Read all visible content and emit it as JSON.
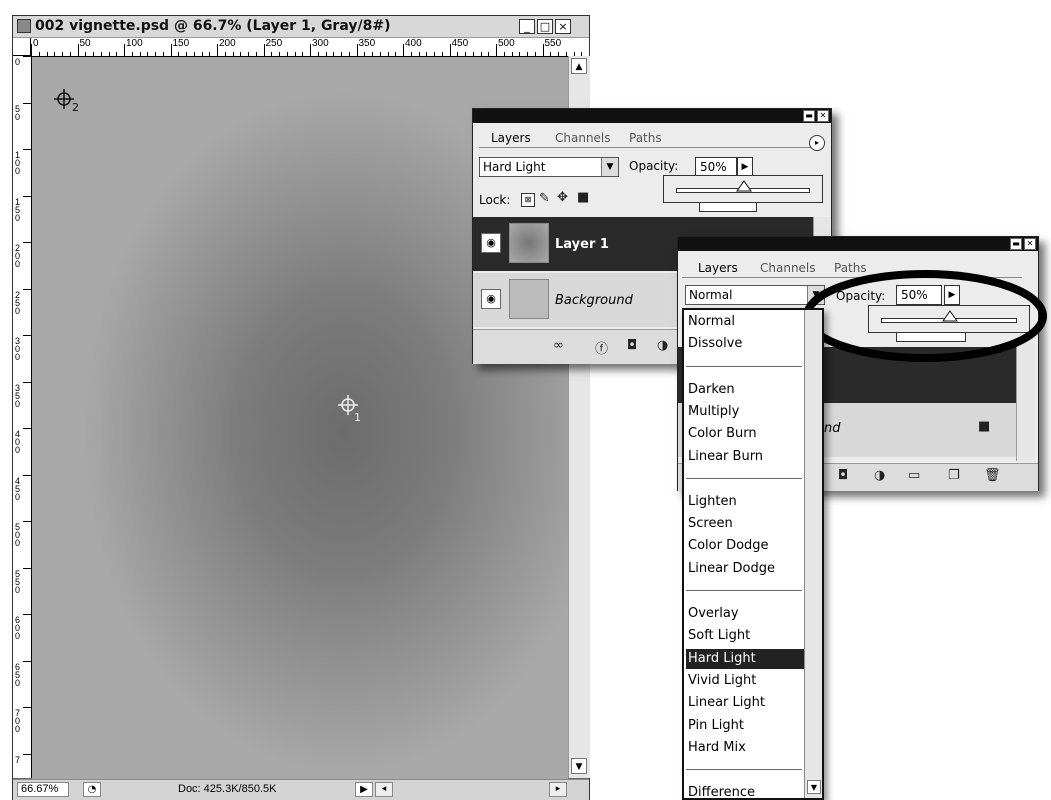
{
  "document": {
    "title": "002 vignette.psd @ 66.7% (Layer 1, Gray/8#)",
    "window_buttons": [
      "_",
      "□",
      "×"
    ],
    "ruler_h": [
      "0",
      "50",
      "100",
      "150",
      "200",
      "250",
      "300",
      "350",
      "400",
      "450",
      "500",
      "550"
    ],
    "ruler_v": [
      "0",
      "50",
      "100",
      "150",
      "200",
      "250",
      "300",
      "350",
      "400",
      "450",
      "500",
      "550",
      "600",
      "650",
      "700",
      "7"
    ],
    "sampler_1_label": "1",
    "sampler_2_label": "2",
    "zoom": "66.67%",
    "doc_size": "Doc: 425.3K/850.5K"
  },
  "panel_back": {
    "tabs": [
      "Layers",
      "Channels",
      "Paths"
    ],
    "blend_mode": "Hard Light",
    "opacity_label": "Opacity:",
    "opacity_value": "50%",
    "opacity_fraction": 0.5,
    "lock_label": "Lock:",
    "layers": [
      {
        "name": "Layer 1",
        "selected": true
      },
      {
        "name": "Background",
        "selected": false
      }
    ]
  },
  "panel_front": {
    "tabs": [
      "Layers",
      "Channels",
      "Paths"
    ],
    "blend_mode": "Normal",
    "opacity_label": "Opacity:",
    "opacity_value": "50%",
    "opacity_fraction": 0.5,
    "bg_layer_partial": "nd"
  },
  "blend_list": {
    "groups": [
      [
        "Normal",
        "Dissolve"
      ],
      [
        "Darken",
        "Multiply",
        "Color Burn",
        "Linear Burn"
      ],
      [
        "Lighten",
        "Screen",
        "Color Dodge",
        "Linear Dodge"
      ],
      [
        "Overlay",
        "Soft Light",
        "Hard Light",
        "Vivid Light",
        "Linear Light",
        "Pin Light",
        "Hard Mix"
      ],
      [
        "Difference"
      ]
    ],
    "selected": "Hard Light"
  },
  "colors": {
    "selected_row": "#2a2a2a",
    "highlight_ring": "#000000"
  }
}
